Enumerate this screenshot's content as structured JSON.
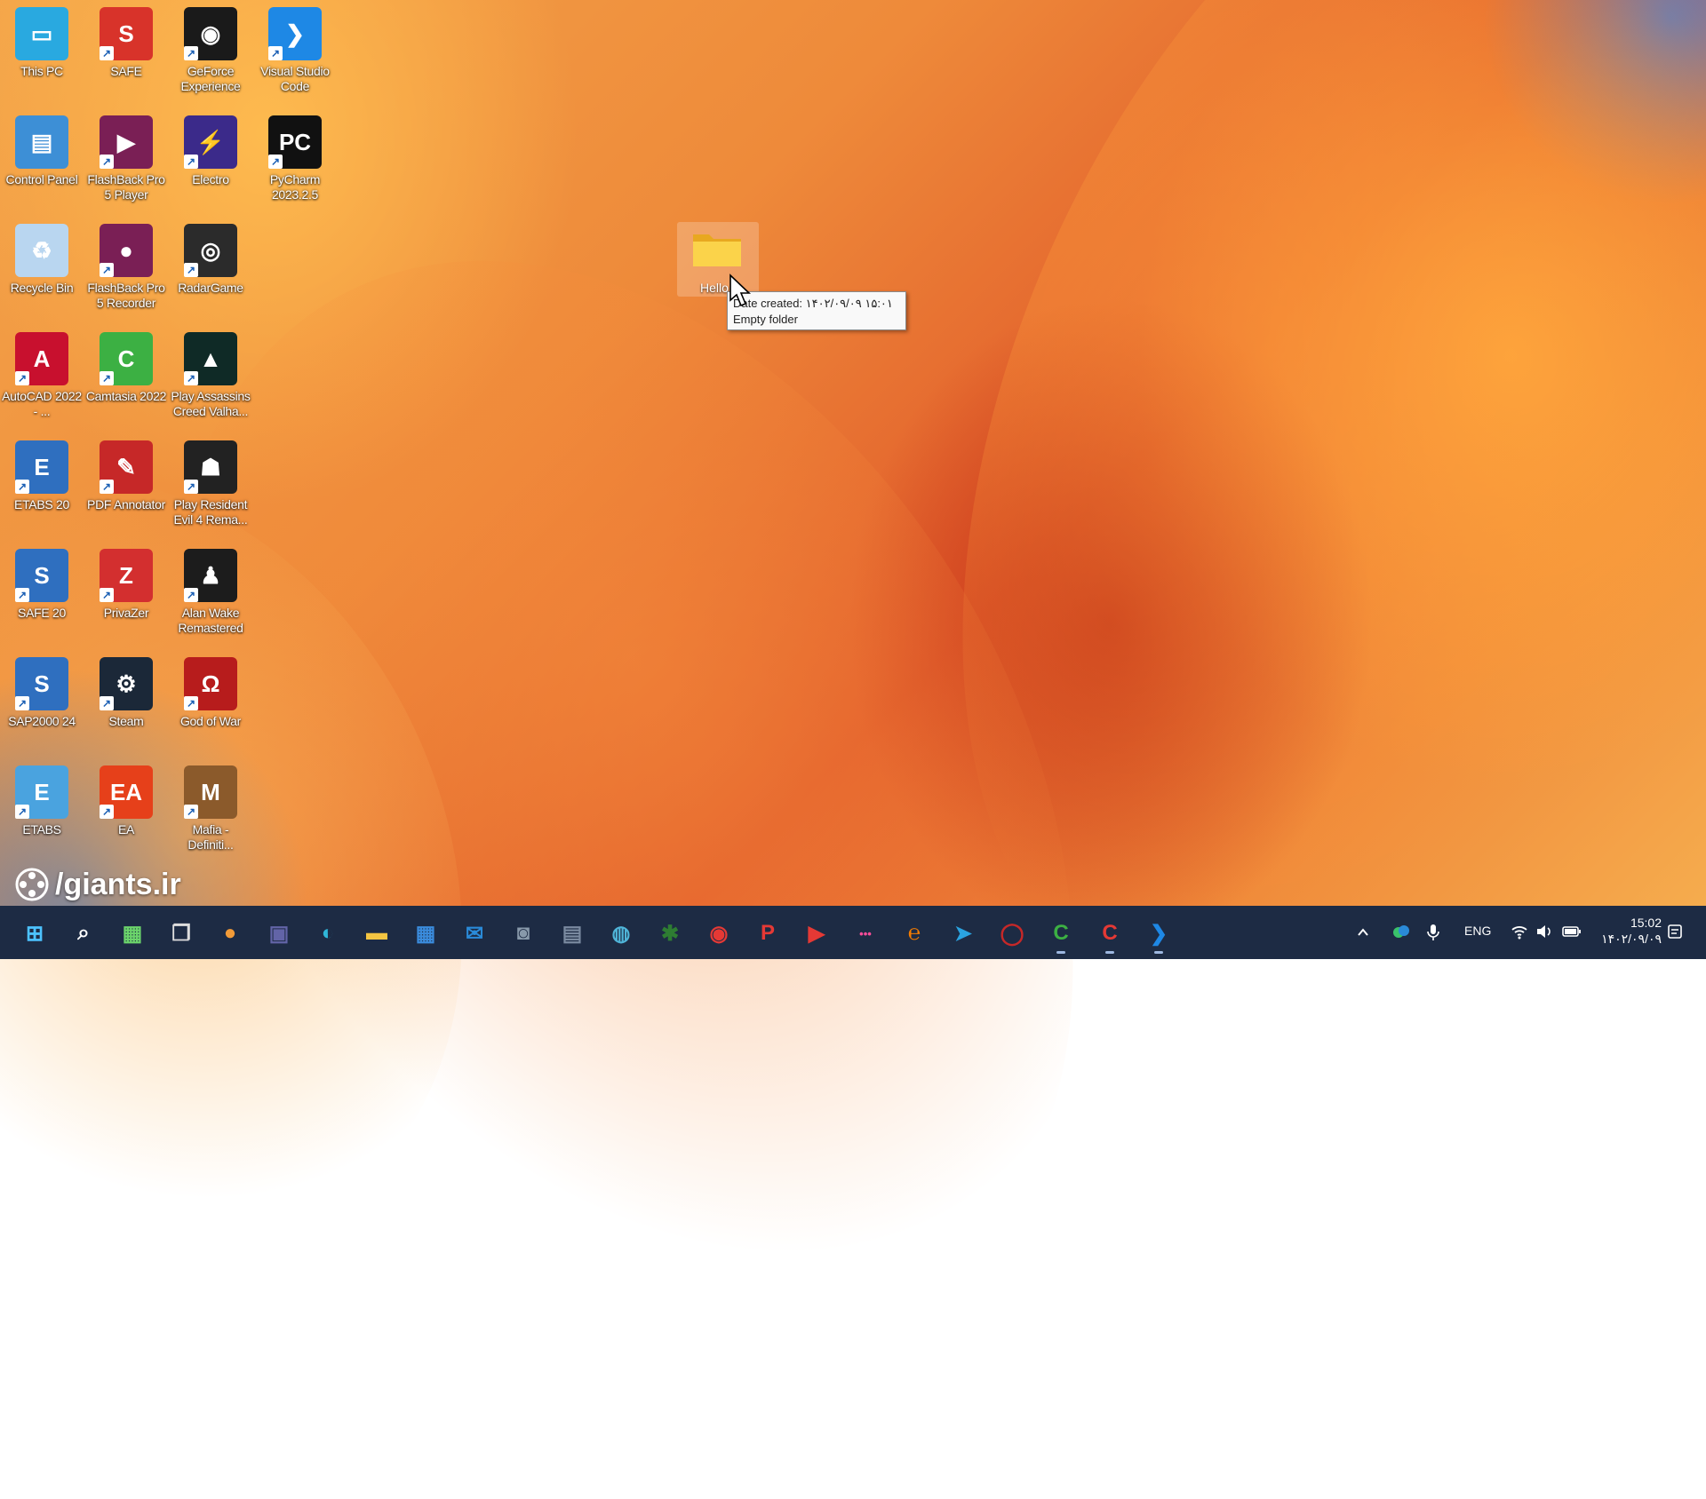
{
  "desktop": {
    "icons": [
      {
        "label": "This PC",
        "name": "this-pc-icon",
        "color": "#29a9e0",
        "glyph": "▭"
      },
      {
        "label": "SAFE",
        "name": "safe-icon",
        "color": "#d8332a",
        "glyph": "S"
      },
      {
        "label": "GeForce Experience",
        "name": "geforce-experience-icon",
        "color": "#1a1a1a",
        "glyph": "◉"
      },
      {
        "label": "Visual Studio Code",
        "name": "visual-studio-code-icon",
        "color": "#1e88e5",
        "glyph": "❯"
      },
      {
        "label": "Control Panel",
        "name": "control-panel-icon",
        "color": "#3d8fd6",
        "glyph": "▤"
      },
      {
        "label": "FlashBack Pro 5 Player",
        "name": "flashback-player-icon",
        "color": "#7a1f55",
        "glyph": "▶"
      },
      {
        "label": "Electro",
        "name": "electro-icon",
        "color": "#3b2a8a",
        "glyph": "⚡"
      },
      {
        "label": "PyCharm 2023.2.5",
        "name": "pycharm-icon",
        "color": "#111111",
        "glyph": "PC"
      },
      {
        "label": "Recycle Bin",
        "name": "recycle-bin-icon",
        "color": "#b9d6f0",
        "glyph": "♻"
      },
      {
        "label": "FlashBack Pro 5 Recorder",
        "name": "flashback-recorder-icon",
        "color": "#7a1f55",
        "glyph": "●"
      },
      {
        "label": "RadarGame",
        "name": "radargame-icon",
        "color": "#2b2b2b",
        "glyph": "◎"
      },
      {
        "label": "AutoCAD 2022 - ...",
        "name": "autocad-icon",
        "color": "#c8102e",
        "glyph": "A"
      },
      {
        "label": "Camtasia 2022",
        "name": "camtasia-icon",
        "color": "#3cb043",
        "glyph": "C"
      },
      {
        "label": "Play Assassins Creed Valha...",
        "name": "assassins-creed-icon",
        "color": "#0f2a26",
        "glyph": "▲"
      },
      {
        "label": "ETABS 20",
        "name": "etabs-20-icon",
        "color": "#2f6fbf",
        "glyph": "E"
      },
      {
        "label": "PDF Annotator",
        "name": "pdf-annotator-icon",
        "color": "#c62828",
        "glyph": "✎"
      },
      {
        "label": "Play Resident Evil 4 Rema...",
        "name": "resident-evil-icon",
        "color": "#222222",
        "glyph": "☗"
      },
      {
        "label": "SAFE 20",
        "name": "safe-20-icon",
        "color": "#2f6fbf",
        "glyph": "S"
      },
      {
        "label": "PrivaZer",
        "name": "privazer-icon",
        "color": "#d32f2f",
        "glyph": "Z"
      },
      {
        "label": "Alan Wake Remastered",
        "name": "alan-wake-icon",
        "color": "#1c1c1c",
        "glyph": "♟"
      },
      {
        "label": "SAP2000 24",
        "name": "sap2000-icon",
        "color": "#2f6fbf",
        "glyph": "S"
      },
      {
        "label": "Steam",
        "name": "steam-icon",
        "color": "#1b2838",
        "glyph": "⚙"
      },
      {
        "label": "God of War",
        "name": "god-of-war-icon",
        "color": "#b71c1c",
        "glyph": "Ω"
      },
      {
        "label": "ETABS",
        "name": "etabs-icon",
        "color": "#4aa3df",
        "glyph": "E"
      },
      {
        "label": "EA",
        "name": "ea-icon",
        "color": "#e6401a",
        "glyph": "EA"
      },
      {
        "label": "Mafia - Definiti...",
        "name": "mafia-icon",
        "color": "#8b5a2b",
        "glyph": "M"
      }
    ],
    "folder": {
      "label": "Hello"
    },
    "tooltip": {
      "line1": "Date created: ۱۴۰۲/۰۹/۰۹ ۱۵:۰۱",
      "line2": "Empty folder"
    },
    "watermark": "/giants.ir"
  },
  "taskbar": {
    "apps": [
      {
        "name": "start-button",
        "glyph": "⊞",
        "color": "#4cc2ff"
      },
      {
        "name": "search-button",
        "glyph": "⌕",
        "color": "#ffffff"
      },
      {
        "name": "widgets-button",
        "glyph": "▦",
        "color": "#6bd46b"
      },
      {
        "name": "task-view-button",
        "glyph": "❐",
        "color": "#dddddd"
      },
      {
        "name": "notification-app-button",
        "glyph": "●",
        "color": "#f29b38"
      },
      {
        "name": "meet-button",
        "glyph": "▣",
        "color": "#6264a7"
      },
      {
        "name": "edge-button",
        "glyph": "◐",
        "color": "#2fb6d8"
      },
      {
        "name": "file-explorer-button",
        "glyph": "▬",
        "color": "#f4c542"
      },
      {
        "name": "store-button",
        "glyph": "▦",
        "color": "#3a8bdc"
      },
      {
        "name": "mail-button",
        "glyph": "✉",
        "color": "#2a8ad8"
      },
      {
        "name": "camera-button",
        "glyph": "◙",
        "color": "#8899aa"
      },
      {
        "name": "calculator-button",
        "glyph": "▤",
        "color": "#7a8aa0"
      },
      {
        "name": "globe-app-button",
        "glyph": "◍",
        "color": "#4fb4d8"
      },
      {
        "name": "green-app-button",
        "glyph": "✱",
        "color": "#2e7d32"
      },
      {
        "name": "chrome-button",
        "glyph": "◉",
        "color": "#e53935"
      },
      {
        "name": "p-app-button",
        "glyph": "P",
        "color": "#e53935"
      },
      {
        "name": "youtube-button",
        "glyph": "▶",
        "color": "#e53935"
      },
      {
        "name": "dots-app-button",
        "glyph": "•••",
        "color": "#ff4d9a"
      },
      {
        "name": "orange-app-button",
        "glyph": "℮",
        "color": "#f57c00"
      },
      {
        "name": "telegram-button",
        "glyph": "➤",
        "color": "#2aa3e0"
      },
      {
        "name": "red-circle-app-button",
        "glyph": "◯",
        "color": "#c62828"
      },
      {
        "name": "camtasia-taskbar-button",
        "glyph": "C",
        "color": "#3cb043"
      },
      {
        "name": "camtasia-recorder-taskbar-button",
        "glyph": "C",
        "color": "#e53935"
      },
      {
        "name": "vscode-taskbar-button",
        "glyph": "❯",
        "color": "#1e88e5"
      }
    ],
    "tray": {
      "lang": "ENG",
      "time": "15:02",
      "date": "۱۴۰۲/۰۹/۰۹"
    }
  }
}
